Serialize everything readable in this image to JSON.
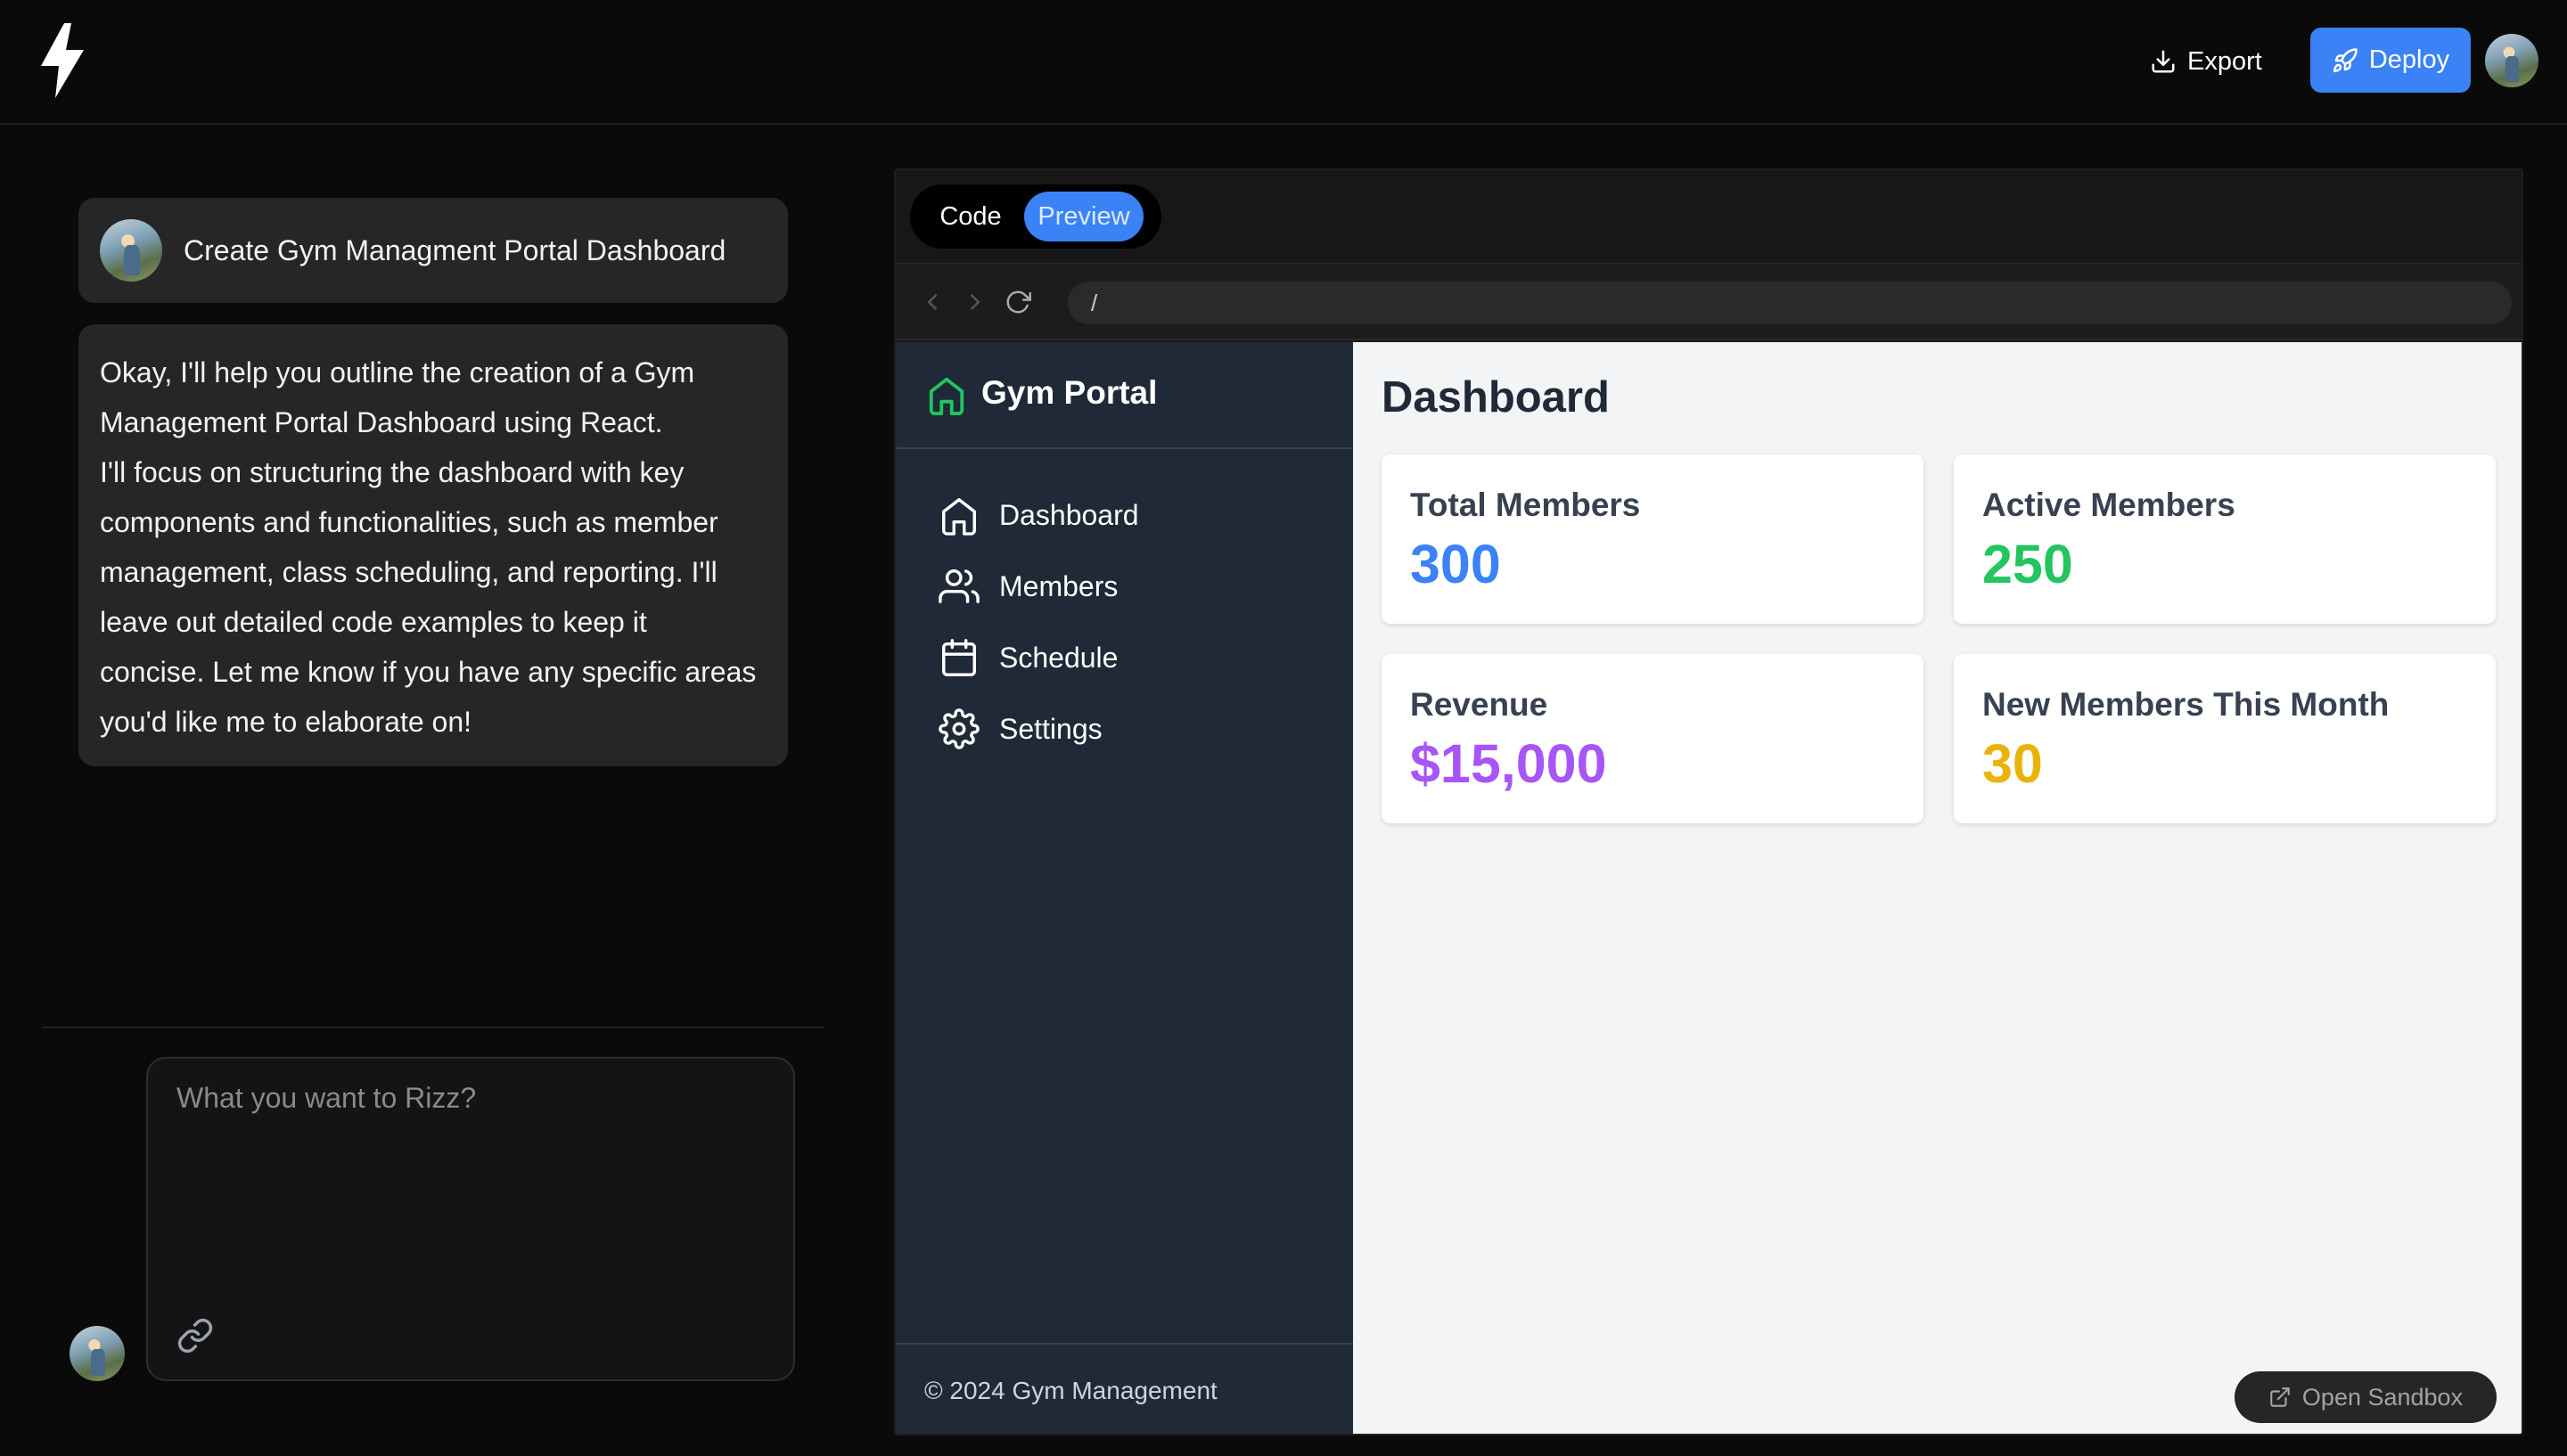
{
  "topbar": {
    "export_label": "Export",
    "deploy_label": "Deploy",
    "accent_color": "#3b82f6"
  },
  "chat": {
    "user_message": "Create Gym Managment Portal Dashboard",
    "assistant_lines": [
      "Okay, I'll help you outline the creation of a Gym",
      "Management Portal Dashboard using React.",
      "I'll focus on structuring the dashboard with key",
      "components and functionalities, such as member",
      "management, class scheduling, and reporting. I'll",
      "leave out detailed code examples to keep it",
      "concise. Let me know if you have any specific areas",
      "you'd like me to elaborate on!"
    ],
    "prompt_placeholder": "What you want to Rizz?"
  },
  "preview": {
    "tab_code": "Code",
    "tab_preview": "Preview",
    "active_tab": "Preview",
    "url": "/",
    "open_sandbox_label": "Open Sandbox"
  },
  "app": {
    "brand": "Gym Portal",
    "brand_color": "#22c55e",
    "nav": [
      {
        "label": "Dashboard",
        "icon": "home-icon"
      },
      {
        "label": "Members",
        "icon": "users-icon"
      },
      {
        "label": "Schedule",
        "icon": "calendar-icon"
      },
      {
        "label": "Settings",
        "icon": "gear-icon"
      }
    ],
    "footer": "© 2024 Gym Management",
    "page_title": "Dashboard",
    "cards": [
      {
        "label": "Total Members",
        "value": "300",
        "color": "#3b82f6"
      },
      {
        "label": "Active Members",
        "value": "250",
        "color": "#22c55e"
      },
      {
        "label": "Revenue",
        "value": "$15,000",
        "color": "#a855f7"
      },
      {
        "label": "New Members This Month",
        "value": "30",
        "color": "#eab308"
      }
    ]
  }
}
